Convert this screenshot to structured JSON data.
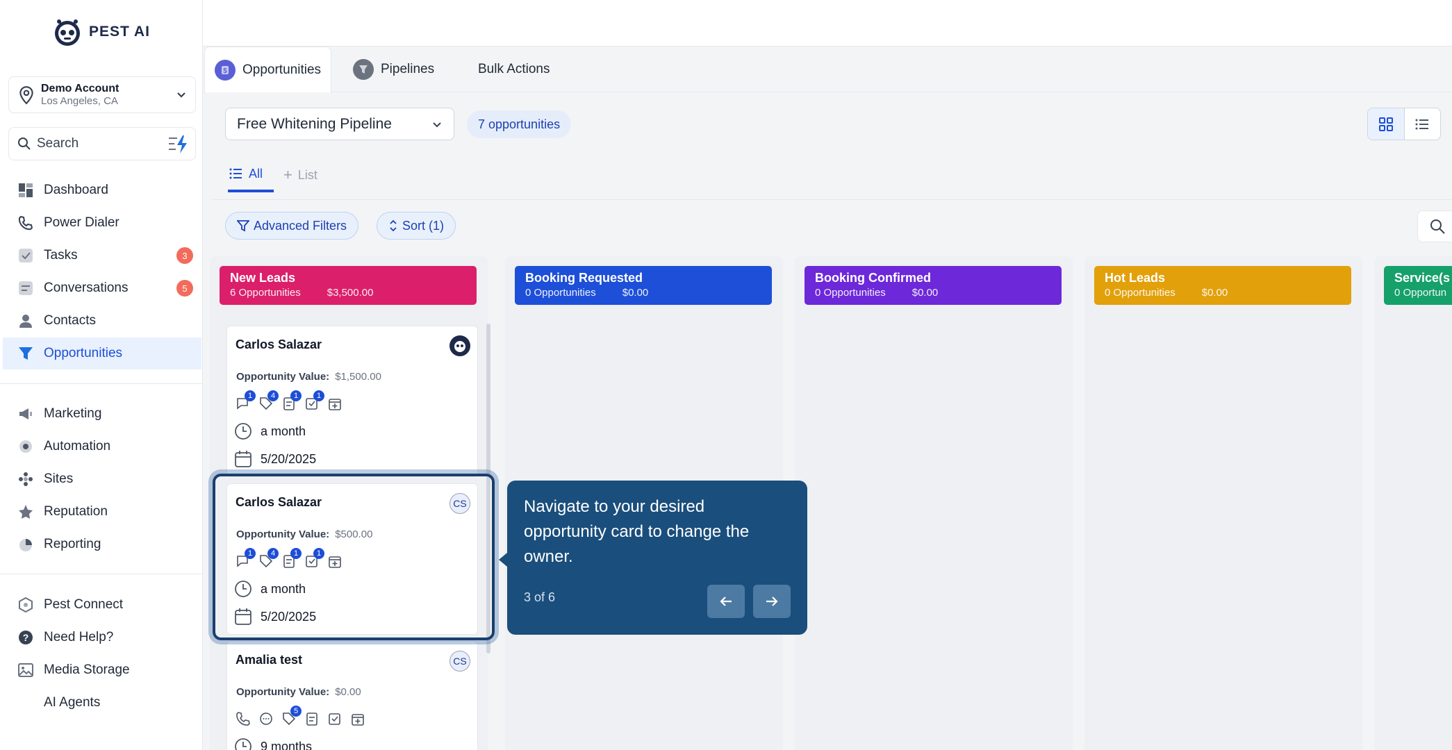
{
  "brand": {
    "name": "PEST AI"
  },
  "account": {
    "name": "Demo Account",
    "location": "Los Angeles, CA"
  },
  "sidebar_search": {
    "placeholder": "Search"
  },
  "nav_primary": [
    {
      "label": "Dashboard",
      "icon": "dashboard-icon"
    },
    {
      "label": "Power Dialer",
      "icon": "phone-icon"
    },
    {
      "label": "Tasks",
      "icon": "tasks-icon",
      "badge": "3"
    },
    {
      "label": "Conversations",
      "icon": "chat-icon",
      "badge": "5"
    },
    {
      "label": "Contacts",
      "icon": "person-icon"
    },
    {
      "label": "Opportunities",
      "icon": "funnel-icon",
      "active": true
    }
  ],
  "nav_secondary": [
    {
      "label": "Marketing",
      "icon": "megaphone-icon"
    },
    {
      "label": "Automation",
      "icon": "automation-icon"
    },
    {
      "label": "Sites",
      "icon": "sites-icon"
    },
    {
      "label": "Reputation",
      "icon": "star-icon"
    },
    {
      "label": "Reporting",
      "icon": "pie-icon"
    }
  ],
  "nav_tertiary": [
    {
      "label": "Pest Connect",
      "icon": "connect-icon"
    },
    {
      "label": "Need Help?",
      "icon": "help-icon"
    },
    {
      "label": "Media Storage",
      "icon": "image-icon"
    },
    {
      "label": "AI Agents",
      "icon": ""
    }
  ],
  "tabs": [
    {
      "label": "Opportunities",
      "icon": "dollar-icon"
    },
    {
      "label": "Pipelines",
      "icon": "funnel-icon"
    },
    {
      "label": "Bulk Actions"
    }
  ],
  "pipeline": {
    "selected": "Free Whitening Pipeline",
    "count_label": "7 opportunities"
  },
  "subtabs": {
    "all": "All",
    "list": "List"
  },
  "filters": {
    "advanced": "Advanced Filters",
    "sort": "Sort (1)"
  },
  "columns": [
    {
      "title": "New Leads",
      "count": "6 Opportunities",
      "value": "$3,500.00",
      "color": "#db1f6b"
    },
    {
      "title": "Booking Requested",
      "count": "0 Opportunities",
      "value": "$0.00",
      "color": "#1d4fd8"
    },
    {
      "title": "Booking Confirmed",
      "count": "0 Opportunities",
      "value": "$0.00",
      "color": "#6d28d9"
    },
    {
      "title": "Hot Leads",
      "count": "0 Opportunities",
      "value": "$0.00",
      "color": "#e2a00b"
    },
    {
      "title": "Service(s",
      "count": "0 Opportun",
      "value": "",
      "color": "#16a06a"
    }
  ],
  "cards": [
    {
      "name": "Carlos Salazar",
      "avatar": "",
      "value_label": "Opportunity Value:",
      "value": "$1,500.00",
      "counts": [
        "1",
        "4",
        "1",
        "1"
      ],
      "age": "a month",
      "date": "5/20/2025"
    },
    {
      "name": "Carlos Salazar",
      "avatar": "CS",
      "value_label": "Opportunity Value:",
      "value": "$500.00",
      "counts": [
        "1",
        "4",
        "1",
        "1"
      ],
      "age": "a month",
      "date": "5/20/2025"
    },
    {
      "name": "Amalia test",
      "avatar": "CS",
      "value_label": "Opportunity Value:",
      "value": "$0.00",
      "counts": [
        "5"
      ],
      "age": "9 months"
    }
  ],
  "tooltip": {
    "message": "Navigate to your desired opportunity card to change the owner.",
    "step": "3 of 6"
  }
}
